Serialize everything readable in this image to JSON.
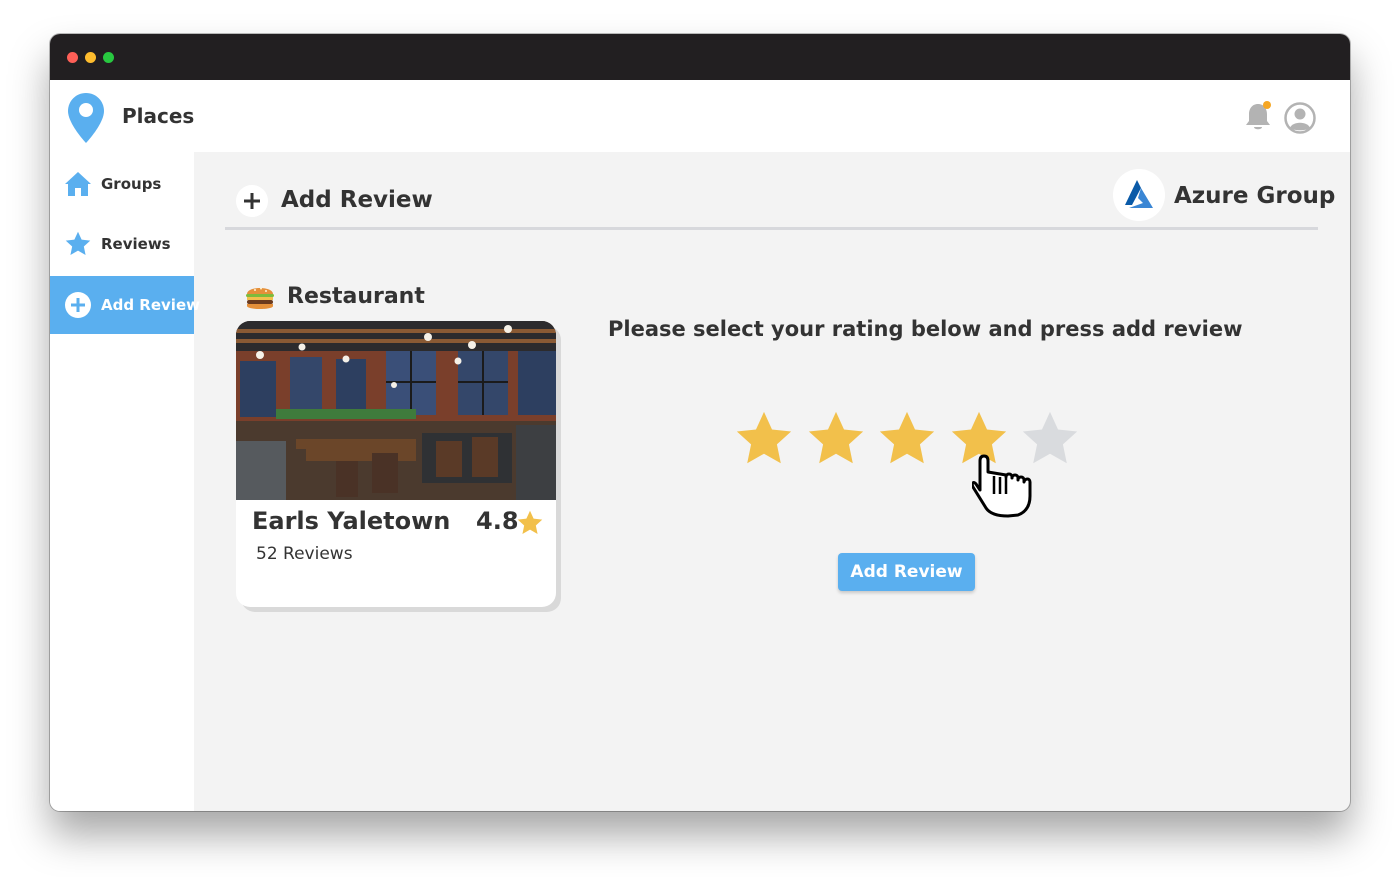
{
  "app": {
    "title": "Places",
    "logo_icon": "location-pin-icon",
    "accent_color": "#5aafef",
    "notification_icon": "bell-icon",
    "profile_icon": "user-avatar-icon"
  },
  "sidebar": {
    "items": [
      {
        "label": "Groups",
        "icon": "home-icon",
        "active": false
      },
      {
        "label": "Reviews",
        "icon": "star-icon",
        "active": false
      },
      {
        "label": "Add Review",
        "icon": "plus-circle-icon",
        "active": true
      }
    ]
  },
  "page": {
    "title": "Add Review",
    "title_icon": "plus-icon"
  },
  "group": {
    "name": "Azure Group",
    "logo_icon": "azure-logo-icon"
  },
  "place": {
    "category": "Restaurant",
    "category_icon": "burger-icon",
    "name": "Earls Yaletown",
    "rating": "4.8",
    "reviews_count": "52 Reviews"
  },
  "review": {
    "prompt": "Please select your rating below and press add review",
    "selected_rating": 4,
    "max_rating": 5,
    "star_color_filled": "#f2c04b",
    "star_color_empty": "#d9dbde",
    "submit_label": "Add Review"
  }
}
